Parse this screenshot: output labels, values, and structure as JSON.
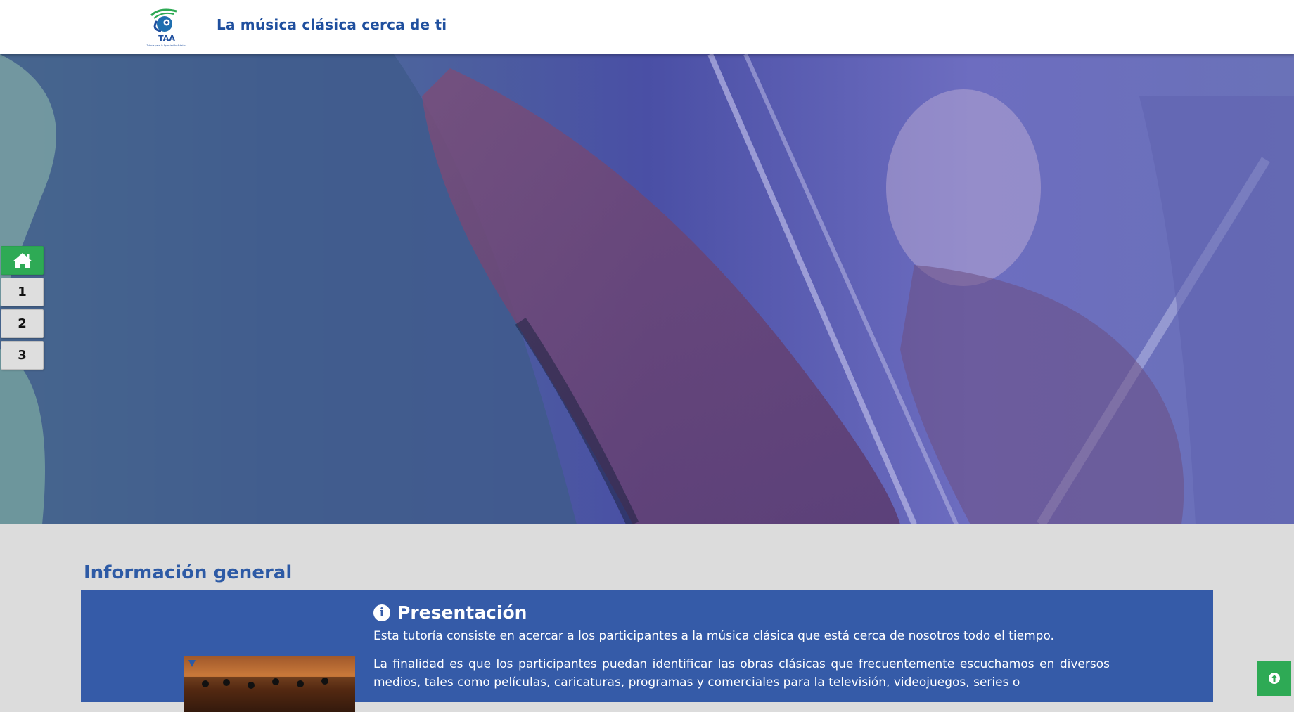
{
  "header": {
    "logo_text": "TAA",
    "logo_subtext": "Tutoría para la Apreciación Artística",
    "title": "La música clásica cerca de ti"
  },
  "hero": {
    "image": "violinists-playing-photo"
  },
  "side_nav": {
    "home_icon": "home-icon",
    "items": [
      "1",
      "2",
      "3"
    ]
  },
  "section": {
    "heading": "Información general",
    "presentation": {
      "icon": "info-icon",
      "title": "Presentación",
      "paragraph1": "Esta tutoría consiste en acercar a los participantes a la música clásica que está cerca de nosotros todo el tiempo.",
      "paragraph2": "La finalidad es que los participantes puedan identificar las obras clásicas que frecuentemente escuchamos en diversos medios, tales como películas, caricaturas, programas y comerciales para la televisión, videojuegos, series o"
    }
  },
  "scroll_top_icon": "arrow-up-circle-icon",
  "colors": {
    "brand_blue": "#1f4f9e",
    "panel_blue": "#355ba8",
    "accent_green": "#2eaa55",
    "page_bg": "#dcdcdc"
  }
}
